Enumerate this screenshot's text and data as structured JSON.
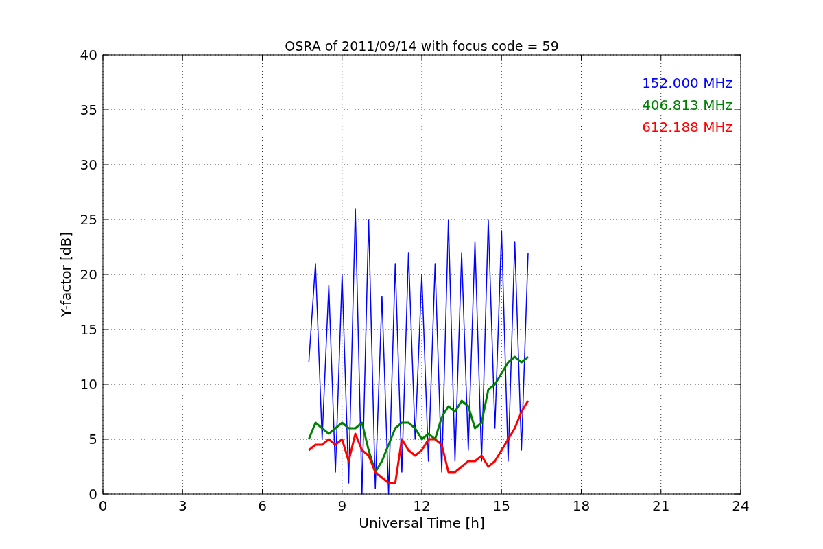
{
  "plot": {
    "chart_data": {
      "type": "line",
      "title": "OSRA of 2011/09/14 with focus code = 59",
      "xlabel": "Universal Time [h]",
      "ylabel": "Y-factor [dB]",
      "x": [
        7.75,
        8,
        8.25,
        8.5,
        8.75,
        9,
        9.25,
        9.5,
        9.75,
        10,
        10.25,
        10.5,
        10.75,
        11,
        11.25,
        11.5,
        11.75,
        12,
        12.25,
        12.5,
        12.75,
        13,
        13.25,
        13.5,
        13.75,
        14,
        14.25,
        14.5,
        14.75,
        15,
        15.25,
        15.5,
        15.75,
        16
      ],
      "series": [
        {
          "name": "152.000 MHz",
          "color": "#0000ff",
          "values": [
            12,
            21,
            5,
            19,
            2,
            20,
            1,
            26,
            0,
            25,
            0.5,
            18,
            0,
            21,
            2,
            22,
            5,
            20,
            3,
            21,
            2,
            25,
            3,
            22,
            4,
            23,
            3,
            25,
            6,
            24,
            3,
            23,
            4,
            22
          ]
        },
        {
          "name": "406.813 MHz",
          "color": "#008000",
          "values": [
            5,
            6.5,
            6,
            5.5,
            6,
            6.5,
            6,
            6,
            6.5,
            4,
            2,
            3,
            4.5,
            6,
            6.5,
            6.5,
            6,
            5,
            5.5,
            5,
            7,
            8,
            7.5,
            8.5,
            8,
            6,
            6.5,
            9.5,
            10,
            11,
            12,
            12.5,
            12,
            12.5
          ]
        },
        {
          "name": "612.188 MHz",
          "color": "#ff0000",
          "values": [
            4,
            4.5,
            4.5,
            5,
            4.5,
            5,
            3,
            5.5,
            4,
            3.5,
            2,
            1.5,
            1,
            1,
            5,
            4,
            3.5,
            4,
            5,
            5,
            4.5,
            2,
            2,
            2.5,
            3,
            3,
            3.5,
            2.5,
            3,
            4,
            5,
            6,
            7.5,
            8.5
          ]
        }
      ],
      "grid": true,
      "xlim": [
        0,
        24
      ],
      "ylim": [
        0,
        40
      ],
      "xticks": [
        0,
        3,
        6,
        9,
        12,
        15,
        18,
        21,
        24
      ],
      "yticks": [
        0,
        5,
        10,
        15,
        20,
        25,
        30,
        35,
        40
      ]
    }
  }
}
